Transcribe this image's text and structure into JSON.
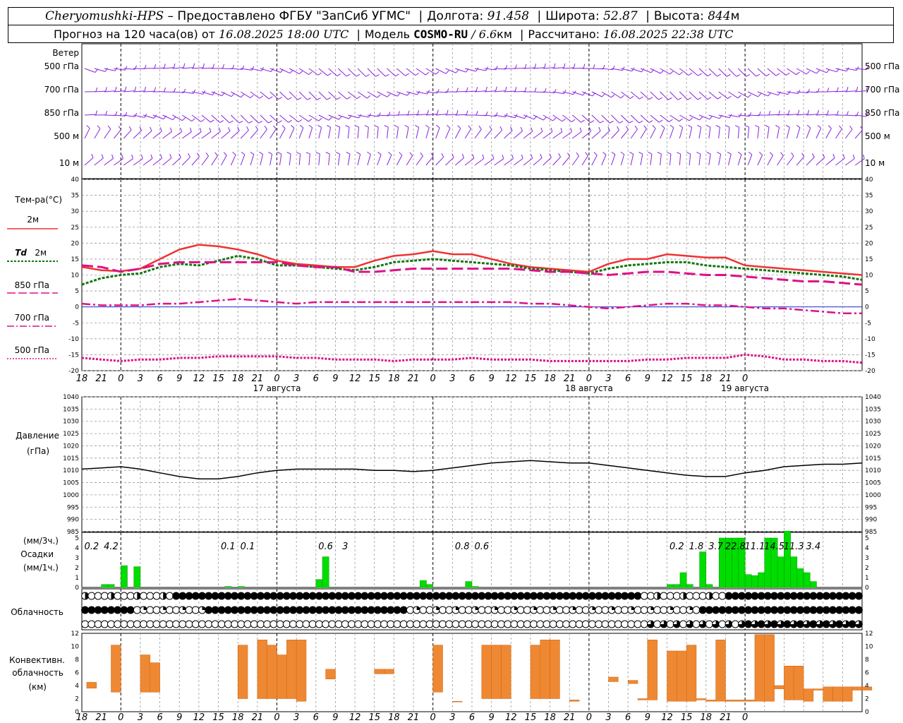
{
  "header": {
    "station": "Cheryomushki-HPS",
    "provider": "– Предоставлено ФГБУ \"ЗапСиб УГМС\"",
    "lon_label": "Долгота:",
    "lon": "91.458",
    "lat_label": "Широта:",
    "lat": "52.87",
    "alt_label": "Высота:",
    "alt": "844",
    "alt_unit": "м",
    "forecast_label": "Прогноз на 120 часа(ов) от",
    "forecast_start": "16.08.2025 18:00 UTC",
    "model_label": "Модель",
    "model": "COSMO-RU",
    "resolution": "/ 6.6",
    "resolution_unit": "км",
    "calc_label": "Рассчитано:",
    "calc_time": "16.08.2025 22:38 UTC"
  },
  "labels": {
    "wind": "Ветер",
    "wind_levels": [
      "500 гПа",
      "700 гПа",
      "850 гПа",
      "500 м",
      "10 м"
    ],
    "temp": "Тем-ра(°C)",
    "t2m": "2м",
    "td_sym": "Td",
    "td2m": "2м",
    "t850": "850 гПа",
    "t700": "700 гПа",
    "t500": "500 гПа",
    "pressure": "Давление",
    "pressure_unit": "(гПа)",
    "precip_unit3": "(мм/3ч.)",
    "precip": "Осадки",
    "precip_unit1": "(мм/1ч.)",
    "cloud": "Облачность",
    "conv1": "Конвективн.",
    "conv2": "облачность",
    "conv3": "(км)"
  },
  "colors": {
    "t2m": "#ee3333",
    "td": "#117711",
    "levels": "#dd1188",
    "wind": "#8822dd",
    "pressure": "#000000",
    "precip": "#00dd00",
    "conv": "#ee8833",
    "grid": "#999999"
  },
  "chart_data": [
    {
      "type": "line",
      "name": "temperature",
      "x_hours": [
        0,
        3,
        6,
        9,
        12,
        15,
        18,
        21,
        24,
        27,
        30,
        33,
        36,
        39,
        42,
        45,
        48,
        51,
        54,
        57,
        60,
        63,
        66,
        69,
        72,
        75,
        78,
        81,
        84,
        87,
        90,
        93,
        96,
        99,
        102,
        105,
        108,
        111,
        114,
        117,
        120
      ],
      "tick_labels": [
        "18",
        "21",
        "0",
        "3",
        "6",
        "9",
        "12",
        "15",
        "18",
        "21",
        "0",
        "3",
        "6",
        "9",
        "12",
        "15",
        "18",
        "21",
        "0",
        "3",
        "6",
        "9",
        "12",
        "15",
        "18",
        "21",
        "0",
        "3",
        "6",
        "9",
        "12",
        "15",
        "18",
        "21",
        "0"
      ],
      "day_labels": [
        {
          "hour": 30,
          "text": "17 августа"
        },
        {
          "hour": 78,
          "text": "18 августа"
        },
        {
          "hour": 102,
          "text": "19 августа"
        }
      ],
      "ylim": [
        -20,
        40
      ],
      "yticks": [
        -20,
        -15,
        -10,
        -5,
        0,
        5,
        10,
        15,
        20,
        25,
        30,
        35,
        40
      ],
      "series": [
        {
          "name": "2м",
          "key": "t2m",
          "values": [
            12.5,
            11.5,
            11.2,
            12.0,
            15.0,
            18.0,
            19.5,
            19.0,
            18.0,
            16.5,
            14.5,
            13.5,
            13.0,
            12.5,
            12.5,
            14.5,
            16.0,
            16.5,
            17.5,
            16.5,
            16.5,
            15.0,
            13.5,
            12.5,
            12.0,
            11.5,
            11.0,
            13.5,
            15.0,
            15.0,
            16.5,
            16.0,
            15.5,
            15.5,
            13.0,
            12.5,
            12.0,
            11.5,
            11.0,
            10.5,
            10.0
          ]
        },
        {
          "name": "Td 2м",
          "key": "td",
          "values": [
            7.0,
            9.0,
            10.0,
            10.5,
            12.5,
            13.5,
            13.0,
            14.5,
            16.0,
            15.0,
            13.0,
            13.0,
            12.5,
            12.0,
            11.5,
            12.5,
            14.0,
            14.5,
            15.0,
            14.5,
            14.0,
            13.5,
            13.0,
            12.0,
            11.5,
            11.0,
            10.5,
            12.0,
            13.0,
            13.5,
            14.0,
            14.0,
            13.0,
            12.5,
            12.0,
            11.5,
            11.0,
            10.5,
            10.0,
            9.5,
            8.5
          ]
        },
        {
          "name": "850 гПа",
          "key": "t850",
          "values": [
            13.0,
            12.5,
            11.0,
            12.0,
            13.5,
            14.0,
            14.0,
            14.0,
            14.0,
            14.0,
            14.0,
            13.0,
            12.5,
            12.5,
            11.0,
            11.0,
            11.5,
            12.0,
            12.0,
            12.0,
            12.0,
            12.0,
            12.0,
            11.5,
            11.0,
            11.0,
            10.5,
            10.0,
            10.5,
            11.0,
            11.0,
            10.5,
            10.0,
            10.0,
            9.5,
            9.0,
            8.5,
            8.0,
            8.0,
            7.5,
            7.0
          ]
        },
        {
          "name": "700 гПа",
          "key": "t700",
          "values": [
            1.0,
            0.5,
            0.5,
            0.5,
            1.0,
            1.0,
            1.5,
            2.0,
            2.5,
            2.0,
            1.5,
            1.0,
            1.5,
            1.5,
            1.5,
            1.5,
            1.5,
            1.5,
            1.5,
            1.5,
            1.5,
            1.5,
            1.5,
            1.0,
            1.0,
            0.5,
            0.0,
            -0.5,
            0.0,
            0.5,
            1.0,
            1.0,
            0.5,
            0.5,
            0.0,
            -0.5,
            -0.5,
            -1.0,
            -1.5,
            -2.0,
            -2.0
          ]
        },
        {
          "name": "500 гПа",
          "key": "t500",
          "values": [
            -16.0,
            -16.5,
            -17.0,
            -16.5,
            -16.5,
            -16.0,
            -16.0,
            -15.5,
            -15.5,
            -15.5,
            -15.5,
            -16.0,
            -16.0,
            -16.5,
            -16.5,
            -16.5,
            -17.0,
            -16.5,
            -16.5,
            -16.5,
            -16.0,
            -16.5,
            -16.5,
            -16.5,
            -17.0,
            -17.0,
            -17.0,
            -17.0,
            -17.0,
            -16.5,
            -16.5,
            -16.0,
            -16.0,
            -16.0,
            -15.0,
            -15.5,
            -16.5,
            -16.5,
            -17.0,
            -17.0,
            -17.5
          ]
        }
      ]
    },
    {
      "type": "line",
      "name": "pressure",
      "x_hours": [
        0,
        3,
        6,
        9,
        12,
        15,
        18,
        21,
        24,
        27,
        30,
        33,
        36,
        39,
        42,
        45,
        48,
        51,
        54,
        57,
        60,
        63,
        66,
        69,
        72,
        75,
        78,
        81,
        84,
        87,
        90,
        93,
        96,
        99,
        102,
        105,
        108,
        111,
        114,
        117,
        120
      ],
      "ylim": [
        985,
        1040
      ],
      "yticks": [
        985,
        990,
        995,
        1000,
        1005,
        1010,
        1015,
        1020,
        1025,
        1030,
        1035,
        1040
      ],
      "values": [
        1010.5,
        1011.0,
        1011.5,
        1010.5,
        1009.0,
        1007.5,
        1006.5,
        1006.5,
        1007.5,
        1009.0,
        1010.0,
        1010.5,
        1010.5,
        1010.5,
        1010.5,
        1010.0,
        1010.0,
        1009.5,
        1010.0,
        1011.0,
        1012.0,
        1013.0,
        1013.5,
        1014.0,
        1013.5,
        1013.0,
        1013.0,
        1012.0,
        1011.0,
        1010.0,
        1009.0,
        1008.0,
        1007.5,
        1007.5,
        1009.0,
        1010.0,
        1011.5,
        1012.0,
        1012.5,
        1012.5,
        1013.0
      ]
    },
    {
      "type": "bar",
      "name": "precipitation",
      "ylim": [
        0,
        5
      ],
      "yticks": [
        0,
        1,
        2,
        3,
        4,
        5
      ],
      "x_hours": [
        0,
        1,
        2,
        3,
        4,
        5,
        6,
        7,
        8,
        9,
        10,
        11,
        12,
        13,
        14,
        15,
        16,
        17,
        18,
        19,
        20,
        21,
        22,
        23,
        24,
        25,
        26,
        27,
        28,
        29,
        30,
        31,
        32,
        33,
        34,
        35,
        36,
        37,
        38,
        39,
        40,
        41,
        42,
        43,
        44,
        45,
        46,
        47,
        48,
        49,
        50,
        51,
        52,
        53,
        54,
        55,
        56,
        57,
        58,
        59,
        60,
        61,
        62,
        63,
        64,
        65,
        66,
        67,
        68,
        69,
        70,
        71,
        72,
        73,
        74,
        75,
        76,
        77,
        78,
        79,
        80,
        81,
        82,
        83,
        84,
        85,
        86,
        87,
        88,
        89,
        90,
        91,
        92,
        93,
        94,
        95,
        96,
        97,
        98,
        99,
        100,
        101,
        102,
        103,
        104,
        105,
        106,
        107,
        108,
        109,
        110,
        111,
        112,
        113,
        114,
        115,
        116,
        117,
        118,
        119
      ],
      "values": [
        0,
        0,
        0,
        0,
        0.3,
        0.3,
        0,
        0,
        0,
        0,
        0,
        0,
        0,
        0,
        0,
        0,
        0,
        0,
        0,
        0,
        0,
        0,
        0,
        0,
        0,
        0,
        0,
        0,
        0,
        0,
        0,
        0,
        0,
        0,
        0,
        0,
        0,
        0,
        0,
        0,
        0,
        0,
        0,
        0,
        0,
        0,
        0,
        0,
        0,
        0,
        0,
        0,
        0,
        0,
        0,
        0,
        0,
        0,
        0,
        0,
        0,
        0,
        0,
        0,
        0,
        0,
        0,
        0,
        0,
        0,
        0,
        0,
        0,
        0,
        0,
        0,
        0,
        0,
        0,
        0,
        0,
        0,
        0,
        0,
        0,
        0,
        0,
        0,
        0,
        0,
        0,
        0,
        0,
        0,
        0,
        0,
        0,
        0,
        0,
        0,
        0,
        0,
        0,
        0,
        0,
        0,
        0,
        0,
        0,
        0,
        0,
        0,
        0,
        0,
        0,
        0,
        0,
        0,
        0,
        0
      ],
      "bars_1h": [
        [
          3,
          0.3
        ],
        [
          4,
          0.3
        ],
        [
          6,
          2.2
        ],
        [
          8,
          2.1
        ],
        [
          22,
          0.1
        ],
        [
          24,
          0.1
        ],
        [
          36,
          0.8
        ],
        [
          37,
          3.1
        ],
        [
          52,
          0.7
        ],
        [
          53,
          0.3
        ],
        [
          59,
          0.6
        ],
        [
          60,
          0.1
        ],
        [
          90,
          0.3
        ],
        [
          91,
          0.3
        ],
        [
          92,
          1.5
        ],
        [
          93,
          0.3
        ],
        [
          95,
          3.6
        ],
        [
          96,
          0.3
        ],
        [
          98,
          5.0
        ],
        [
          99,
          5.0
        ],
        [
          100,
          5.0
        ],
        [
          101,
          5.0
        ],
        [
          102,
          1.3
        ],
        [
          103,
          1.2
        ],
        [
          104,
          1.5
        ],
        [
          105,
          5.0
        ],
        [
          106,
          5.0
        ],
        [
          107,
          3.1
        ],
        [
          108,
          5.7
        ],
        [
          109,
          3.1
        ],
        [
          110,
          1.9
        ],
        [
          111,
          1.5
        ],
        [
          112,
          0.6
        ]
      ],
      "totals_3h": [
        {
          "hour": 1.5,
          "text": "0.2"
        },
        {
          "hour": 4.5,
          "text": "4.2"
        },
        {
          "hour": 22.5,
          "text": "0.1"
        },
        {
          "hour": 25.5,
          "text": "0.1"
        },
        {
          "hour": 37.5,
          "text": "0.6"
        },
        {
          "hour": 40.5,
          "text": "3"
        },
        {
          "hour": 58.5,
          "text": "0.8"
        },
        {
          "hour": 61.5,
          "text": "0.6"
        },
        {
          "hour": 91.5,
          "text": "0.2"
        },
        {
          "hour": 94.5,
          "text": "1.8"
        },
        {
          "hour": 97.5,
          "text": "3.7"
        },
        {
          "hour": 100.5,
          "text": "22.8"
        },
        {
          "hour": 103.5,
          "text": "11.1"
        },
        {
          "hour": 106.5,
          "text": "14.5"
        },
        {
          "hour": 109.5,
          "text": "11.3"
        },
        {
          "hour": 112.5,
          "text": "3.4"
        }
      ]
    },
    {
      "type": "bar",
      "name": "convective_cloud",
      "ylim": [
        0,
        12
      ],
      "yticks": [
        0,
        2,
        4,
        6,
        8,
        10,
        12
      ],
      "bars": [
        [
          0.5,
          3.6,
          4.5
        ],
        [
          3,
          3,
          10.2
        ],
        [
          6,
          3,
          8.7
        ],
        [
          7,
          3,
          7.5
        ],
        [
          16,
          2,
          10.2
        ],
        [
          18,
          2,
          11
        ],
        [
          19,
          2,
          10.2
        ],
        [
          20,
          2,
          8.7
        ],
        [
          21,
          2,
          11
        ],
        [
          22,
          1.6,
          11
        ],
        [
          25,
          5,
          6.5
        ],
        [
          30,
          5.8,
          6.5
        ],
        [
          31,
          5.8,
          6.5
        ],
        [
          36,
          3,
          10.2
        ],
        [
          38,
          1.5,
          1.6
        ],
        [
          41,
          2,
          10.2
        ],
        [
          42,
          2,
          10.2
        ],
        [
          43,
          2,
          10.2
        ],
        [
          46,
          2,
          10.2
        ],
        [
          47,
          2,
          11
        ],
        [
          48,
          2,
          11
        ],
        [
          50,
          1.6,
          1.8
        ],
        [
          54,
          4.6,
          5.3
        ],
        [
          56,
          4.3,
          4.8
        ],
        [
          57,
          1.8,
          2
        ],
        [
          58,
          1.8,
          11
        ],
        [
          60,
          1.6,
          9.3
        ],
        [
          61,
          1.6,
          9.3
        ],
        [
          62,
          1.6,
          10.2
        ],
        [
          63,
          1.8,
          2
        ],
        [
          64,
          1.6,
          1.8
        ],
        [
          65,
          1.6,
          11
        ],
        [
          66,
          1.6,
          1.8
        ],
        [
          67,
          1.6,
          1.8
        ],
        [
          68,
          1.6,
          1.8
        ],
        [
          69,
          1.6,
          11.8
        ],
        [
          70,
          1.6,
          11.8
        ],
        [
          71,
          3.5,
          4
        ],
        [
          72,
          1.8,
          7
        ],
        [
          73,
          1.8,
          7
        ],
        [
          74,
          1.6,
          3.5
        ],
        [
          75,
          3.3,
          3.5
        ],
        [
          76,
          1.6,
          3.8
        ],
        [
          77,
          1.6,
          3.8
        ],
        [
          78,
          1.6,
          3.8
        ],
        [
          79,
          3.3,
          3.8
        ],
        [
          80,
          3.3,
          3.8
        ]
      ]
    }
  ]
}
